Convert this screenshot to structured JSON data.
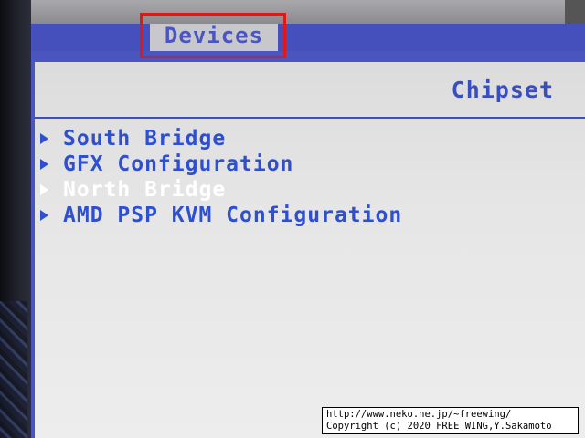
{
  "tabs": {
    "active_label": "Devices"
  },
  "panel": {
    "title": "Chipset"
  },
  "menu": {
    "items": [
      {
        "label": "South Bridge",
        "selected": false
      },
      {
        "label": "GFX Configuration",
        "selected": false
      },
      {
        "label": "North Bridge",
        "selected": true
      },
      {
        "label": "AMD PSP KVM Configuration",
        "selected": false
      }
    ]
  },
  "watermark": {
    "line1": "http://www.neko.ne.jp/~freewing/",
    "line2": "Copyright (c) 2020 FREE WING,Y.Sakamoto"
  },
  "colors": {
    "bios_blue": "#4a55c0",
    "menu_text": "#2e4fd0",
    "selected_text": "#ffffff",
    "highlight_box": "#e01818",
    "panel_bg": "#e6e6e6"
  }
}
